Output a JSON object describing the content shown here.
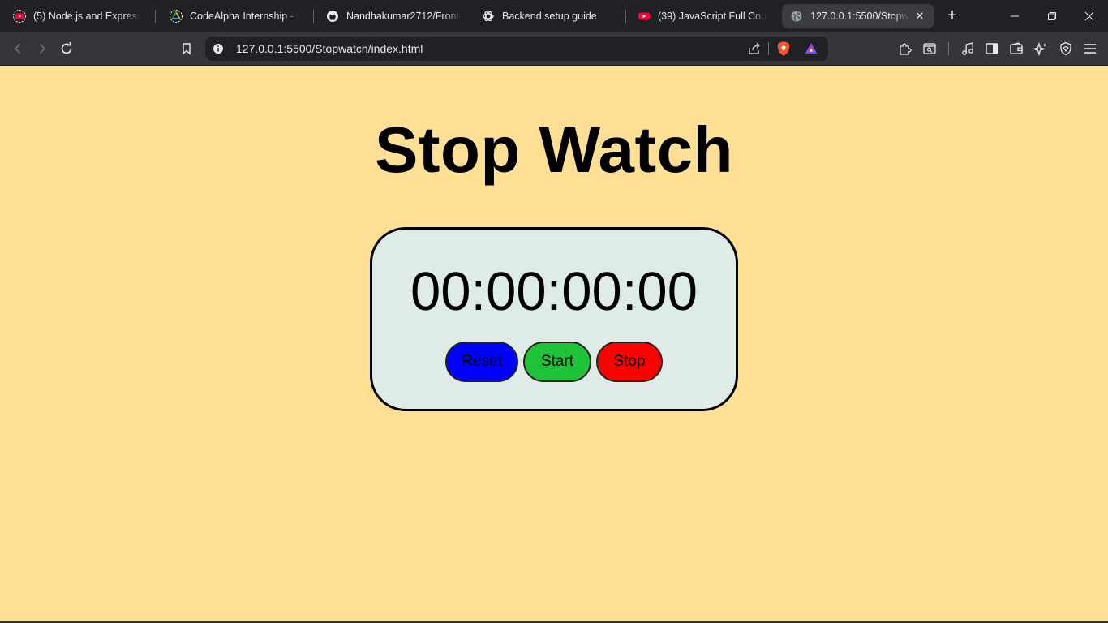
{
  "browser": {
    "tabs": [
      {
        "label": "(5) Node.js and Express.js -",
        "icon": "youtube-icon",
        "active": false
      },
      {
        "label": "CodeAlpha Internship - Mo",
        "icon": "google-drive-icon",
        "active": false
      },
      {
        "label": "Nandhakumar2712/Front-E",
        "icon": "github-icon",
        "active": false
      },
      {
        "label": "Backend setup guide",
        "icon": "chatgpt-icon",
        "active": false
      },
      {
        "label": "(39) JavaScript Full Course",
        "icon": "youtube-icon",
        "active": false
      },
      {
        "label": "127.0.0.1:5500/Stopwa",
        "icon": "globe-icon",
        "active": true
      }
    ],
    "new_tab": "+",
    "address": "127.0.0.1:5500/Stopwatch/index.html",
    "colors": {
      "tabbar": "#202124",
      "toolbar": "#35363a",
      "omnibox": "#202124"
    }
  },
  "page": {
    "title": "Stop Watch",
    "time": "00:00:00:00",
    "buttons": {
      "reset": "Reset",
      "start": "Start",
      "stop": "Stop"
    },
    "colors": {
      "background": "#ffdf93",
      "panel": "#deebe6",
      "reset": "#0000ff",
      "start": "#1ec33a",
      "stop": "#ff0000"
    }
  }
}
